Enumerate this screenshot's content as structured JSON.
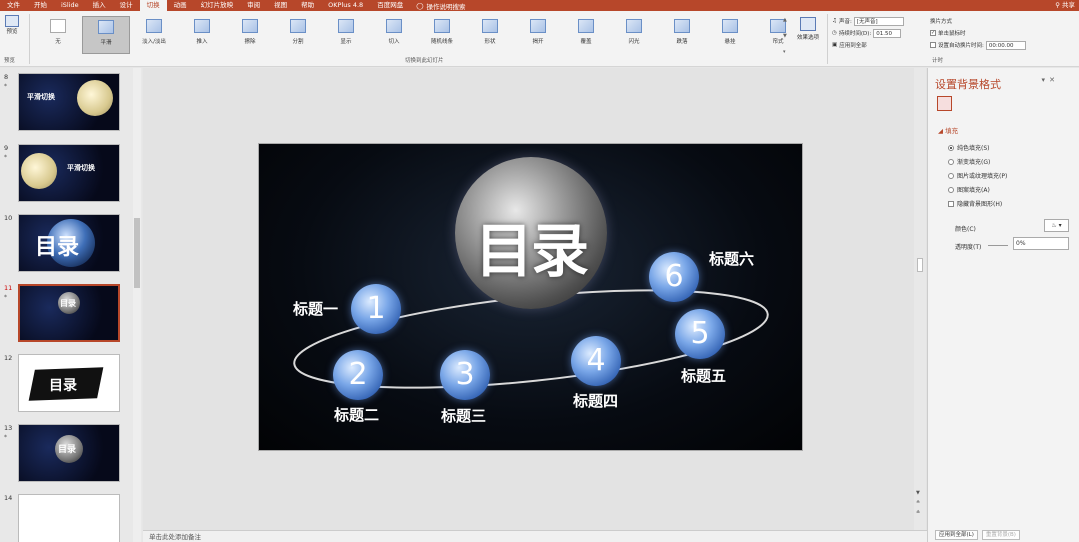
{
  "tabs": [
    "文件",
    "开始",
    "iSlide",
    "插入",
    "设计",
    "切换",
    "动画",
    "幻灯片放映",
    "审阅",
    "视图",
    "帮助",
    "OKPlus 4.8",
    "百度网盘"
  ],
  "active_tab_index": 5,
  "tell_me": "操作说明搜索",
  "share": "共享",
  "ribbon": {
    "preview_label": "预览",
    "preview_group": "预览",
    "effects": [
      "无",
      "平滑",
      "淡入/淡出",
      "推入",
      "擦除",
      "分割",
      "显示",
      "切入",
      "随机线条",
      "形状",
      "揭开",
      "覆盖",
      "闪光",
      "跌落",
      "悬挂",
      "帘式"
    ],
    "selected_effect_index": 1,
    "effects_group": "切换到此幻灯片",
    "effect_options": "效果选项",
    "sound_label": "声音:",
    "sound_value": "[无声音]",
    "duration_label": "持续时间(D):",
    "duration_value": "01.50",
    "apply_all": "应用到全部",
    "timing_group": "计时",
    "advance_title": "换片方式",
    "on_click": "单击鼠标时",
    "on_click_checked": true,
    "auto_after": "设置自动换片时间:",
    "auto_after_checked": false,
    "auto_after_value": "00:00.00"
  },
  "thumbnails": [
    {
      "num": "8",
      "star": "*",
      "title": "平滑切换"
    },
    {
      "num": "9",
      "star": "*",
      "title": "平滑切换"
    },
    {
      "num": "10",
      "star": "",
      "title": "目录"
    },
    {
      "num": "11",
      "star": "*",
      "title": "目录",
      "selected": true
    },
    {
      "num": "12",
      "star": "",
      "title": "目录"
    },
    {
      "num": "13",
      "star": "*",
      "title": "目录"
    },
    {
      "num": "14",
      "star": "",
      "title": ""
    }
  ],
  "slide": {
    "title": "目录",
    "items": [
      {
        "n": "1",
        "label": "标题一"
      },
      {
        "n": "2",
        "label": "标题二"
      },
      {
        "n": "3",
        "label": "标题三"
      },
      {
        "n": "4",
        "label": "标题四"
      },
      {
        "n": "5",
        "label": "标题五"
      },
      {
        "n": "6",
        "label": "标题六"
      }
    ]
  },
  "notes_placeholder": "单击此处添加备注",
  "pane": {
    "title": "设置背景格式",
    "section": "填充",
    "options": [
      "纯色填充(S)",
      "渐变填充(G)",
      "图片或纹理填充(P)",
      "图案填充(A)"
    ],
    "selected_option_index": 0,
    "hide_bg": "隐藏背景图形(H)",
    "color_label": "颜色(C)",
    "transparency_label": "透明度(T)",
    "transparency_value": "0%",
    "apply_all": "应用到全部(L)",
    "reset": "重置背景(B)"
  }
}
